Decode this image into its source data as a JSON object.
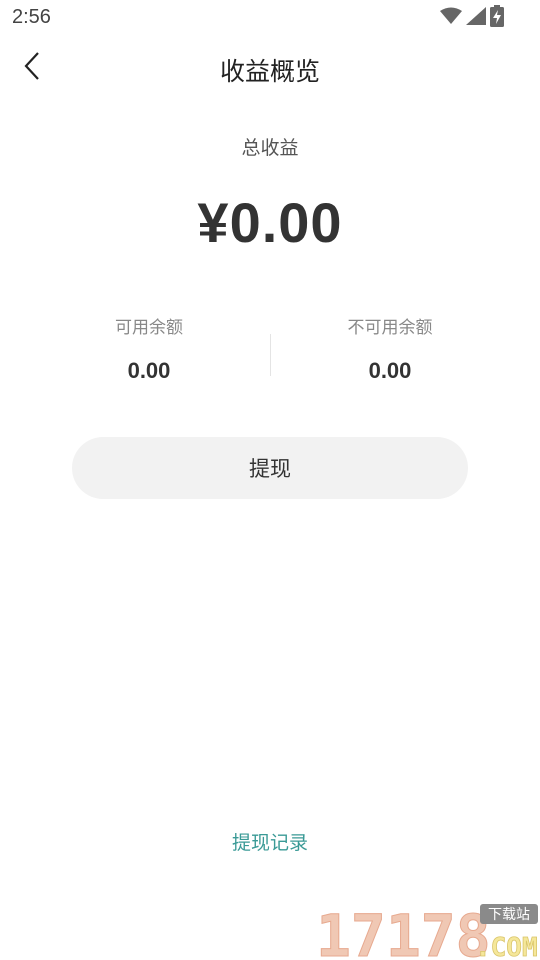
{
  "status_bar": {
    "time": "2:56",
    "icons": [
      "wifi-icon",
      "cell-signal-icon",
      "battery-charging-icon"
    ]
  },
  "header": {
    "title": "收益概览",
    "back_icon": "chevron-left-icon"
  },
  "summary": {
    "total_label": "总收益",
    "total_amount": "¥0.00"
  },
  "balances": {
    "available_label": "可用余额",
    "available_value": "0.00",
    "unavailable_label": "不可用余额",
    "unavailable_value": "0.00"
  },
  "actions": {
    "withdraw_label": "提现",
    "history_label": "提现记录"
  },
  "watermark": {
    "number": "17178",
    "suffix": ".COM",
    "tag": "下载站"
  },
  "colors": {
    "link": "#3a9a96",
    "button_bg": "#f2f2f2",
    "text_primary": "#333333",
    "text_secondary": "#888888"
  }
}
